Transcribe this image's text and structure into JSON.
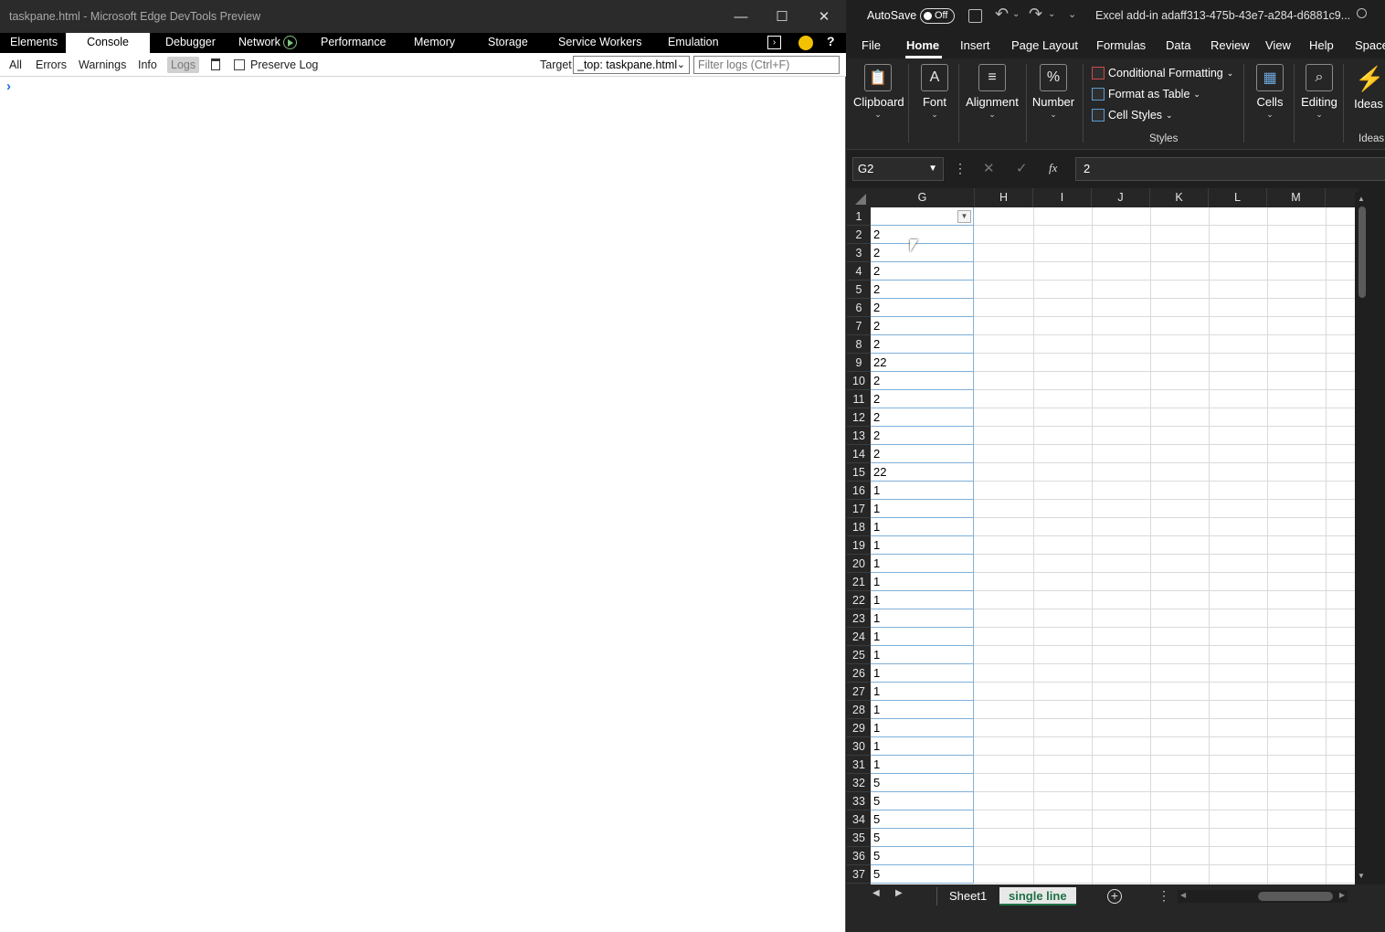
{
  "devtools": {
    "title": "taskpane.html - Microsoft Edge DevTools Preview",
    "window_controls": {
      "minimize": "—",
      "maximize": "☐",
      "close": "✕"
    },
    "tabs": [
      {
        "label": "Elements"
      },
      {
        "label": "Console"
      },
      {
        "label": "Debugger"
      },
      {
        "label": "Network"
      },
      {
        "label": "Performance"
      },
      {
        "label": "Memory"
      },
      {
        "label": "Storage"
      },
      {
        "label": "Service Workers"
      },
      {
        "label": "Emulation"
      }
    ],
    "active_tab": "Console",
    "filters": [
      {
        "label": "All"
      },
      {
        "label": "Errors"
      },
      {
        "label": "Warnings"
      },
      {
        "label": "Info"
      },
      {
        "label": "Logs"
      }
    ],
    "active_filter": "Logs",
    "preserve_log_label": "Preserve Log",
    "target_label": "Target",
    "target_value": "_top: taskpane.html",
    "filter_placeholder": "Filter logs (Ctrl+F)",
    "prompt_symbol": "›"
  },
  "excel": {
    "autosave_label": "AutoSave",
    "autosave_state": "Off",
    "title": "Excel add-in adaff313-475b-43e7-a284-d6881c9...",
    "ribbon_tabs": [
      {
        "label": "File"
      },
      {
        "label": "Home"
      },
      {
        "label": "Insert"
      },
      {
        "label": "Page Layout"
      },
      {
        "label": "Formulas"
      },
      {
        "label": "Data"
      },
      {
        "label": "Review"
      },
      {
        "label": "View"
      },
      {
        "label": "Help"
      },
      {
        "label": "Space"
      }
    ],
    "active_ribbon_tab": "Home",
    "ribbon_groups": {
      "clipboard": "Clipboard",
      "font": "Font",
      "alignment": "Alignment",
      "number": "Number",
      "conditional_formatting": "Conditional Formatting",
      "format_as_table": "Format as Table",
      "cell_styles": "Cell Styles",
      "styles": "Styles",
      "cells": "Cells",
      "editing": "Editing",
      "ideas": "Ideas",
      "ideas_group": "Ideas"
    },
    "name_box": "G2",
    "formula_value": "2",
    "fx_label": "fx",
    "columns": [
      "G",
      "H",
      "I",
      "J",
      "K",
      "L",
      "M"
    ],
    "rows": [
      "1",
      "2",
      "3",
      "4",
      "5",
      "6",
      "7",
      "8",
      "9",
      "10",
      "11",
      "12",
      "13",
      "14",
      "15",
      "16",
      "17",
      "18",
      "19",
      "20",
      "21",
      "22",
      "23",
      "24",
      "25",
      "26",
      "27",
      "28",
      "29",
      "30",
      "31",
      "32",
      "33",
      "34",
      "35",
      "36",
      "37"
    ],
    "column_g_values": [
      "",
      "2",
      "2",
      "2",
      "2",
      "2",
      "2",
      "2",
      "22",
      "2",
      "2",
      "2",
      "2",
      "2",
      "22",
      "1",
      "1",
      "1",
      "1",
      "1",
      "1",
      "1",
      "1",
      "1",
      "1",
      "1",
      "1",
      "1",
      "1",
      "1",
      "1",
      "5",
      "5",
      "5",
      "5",
      "5",
      "5"
    ],
    "sheets": [
      {
        "label": "Sheet1"
      },
      {
        "label": "single line"
      }
    ],
    "active_sheet": "single line"
  }
}
